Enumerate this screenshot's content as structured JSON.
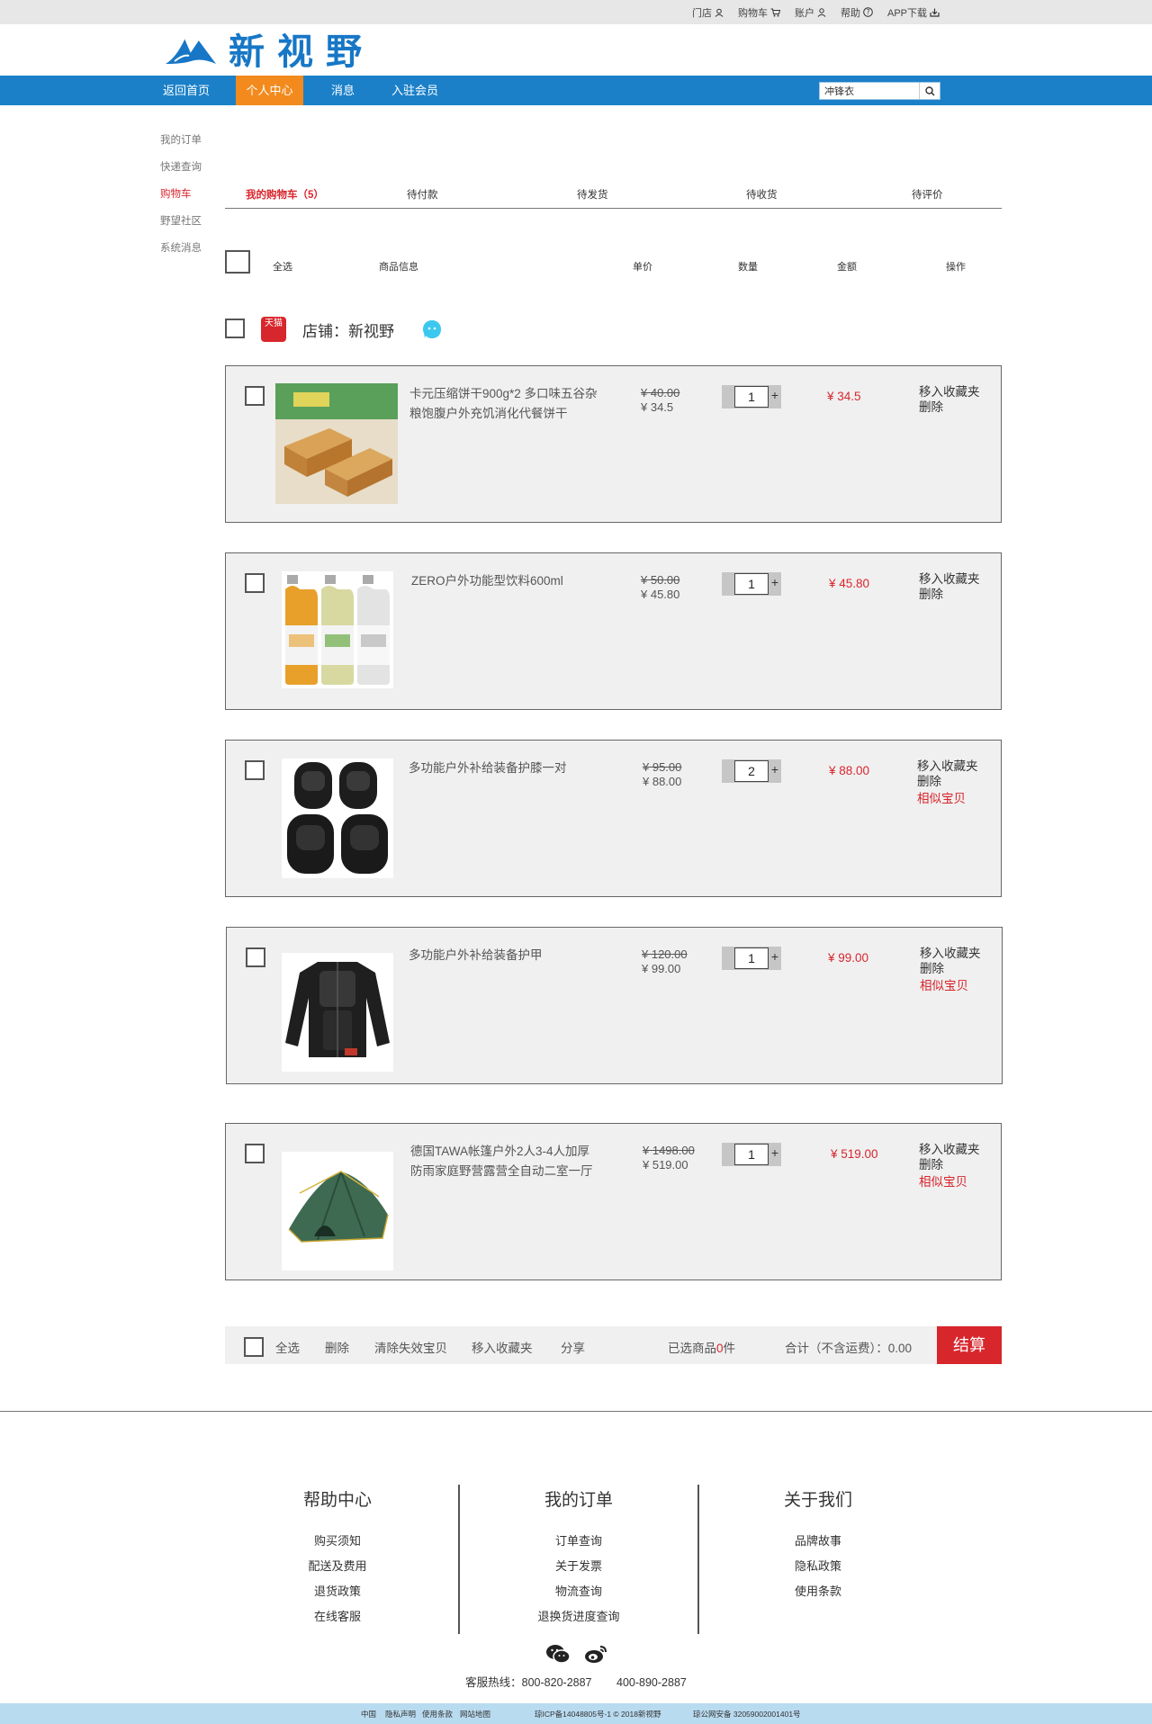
{
  "topbar": {
    "links": [
      {
        "label": "门店",
        "icon": "user-icon"
      },
      {
        "label": "购物车",
        "icon": "cart-icon"
      },
      {
        "label": "账户",
        "icon": "person-icon"
      },
      {
        "label": "帮助",
        "icon": "help-icon"
      },
      {
        "label": "APP下载",
        "icon": "download-icon"
      }
    ]
  },
  "logo": {
    "text": "新视野"
  },
  "nav": {
    "items": [
      "返回首页",
      "个人中心",
      "消息",
      "入驻会员"
    ],
    "active": "个人中心",
    "search_value": "冲锋衣"
  },
  "sidebar": {
    "items": [
      "我的订单",
      "快递查询",
      "购物车",
      "野望社区",
      "系统消息"
    ],
    "active": "购物车"
  },
  "tabs": [
    "我的购物车（5）",
    "待付款",
    "待发货",
    "待收货",
    "待评价"
  ],
  "table_header": [
    "全选",
    "商品信息",
    "单价",
    "数量",
    "金额",
    "操作"
  ],
  "shop": {
    "badge": "天猫",
    "name": "店铺：新视野"
  },
  "items": [
    {
      "title": "卡元压缩饼干900g*2 多口味五谷杂粮饱腹户外充饥消化代餐饼干",
      "orig_price": "¥ 40.00",
      "price": "¥ 34.5",
      "qty": "1",
      "subtotal": "¥ 34.5",
      "ops": [
        "移入收藏夹",
        "删除"
      ],
      "similar": "",
      "image": "biscuit-image"
    },
    {
      "title": "ZERO户外功能型饮料600ml",
      "orig_price": "¥ 50.00",
      "price": "¥ 45.80",
      "qty": "1",
      "subtotal": "¥ 45.80",
      "ops": [
        "移入收藏夹",
        "删除"
      ],
      "similar": "",
      "image": "drink-bottles-image"
    },
    {
      "title": "多功能户外补给装备护膝一对",
      "orig_price": "¥ 95.00",
      "price": "¥ 88.00",
      "qty": "2",
      "subtotal": "¥ 88.00",
      "ops": [
        "移入收藏夹",
        "删除"
      ],
      "similar": "相似宝贝",
      "image": "knee-pads-image"
    },
    {
      "title": "多功能户外补给装备护甲",
      "orig_price": "¥ 120.00",
      "price": "¥ 99.00",
      "qty": "1",
      "subtotal": "¥ 99.00",
      "ops": [
        "移入收藏夹",
        "删除"
      ],
      "similar": "相似宝贝",
      "image": "armor-jacket-image"
    },
    {
      "title": "德国TAWA帐篷户外2人3-4人加厚防雨家庭野营露营全自动二室一厅",
      "orig_price": "¥ 1498.00",
      "price": "¥ 519.00",
      "qty": "1",
      "subtotal": "¥ 519.00",
      "ops": [
        "移入收藏夹",
        "删除"
      ],
      "similar": "相似宝贝",
      "image": "tent-image"
    }
  ],
  "bottom_bar": {
    "select_all": "全选",
    "delete": "删除",
    "clear_invalid": "清除失效宝贝",
    "move_fav": "移入收藏夹",
    "share": "分享",
    "selected_prefix": "已选商品",
    "selected_count": "0",
    "selected_suffix": "件",
    "total_label": "合计（不含运费）：",
    "total_value": "0.00",
    "checkout": "结算"
  },
  "footer": {
    "columns": [
      {
        "title": "帮助中心",
        "links": [
          "购买须知",
          "配送及费用",
          "退货政策",
          "在线客服"
        ]
      },
      {
        "title": "我的订单",
        "links": [
          "订单查询",
          "关于发票",
          "物流查询",
          "退换货进度查询"
        ]
      },
      {
        "title": "关于我们",
        "links": [
          "品牌故事",
          "隐私政策",
          "使用条款"
        ]
      }
    ],
    "hotline_label": "客服热线：",
    "phone1": "800-820-2887",
    "phone2": "400-890-2887",
    "copyright_links": [
      "中国",
      "隐私声明",
      "使用条款",
      "网站地图"
    ],
    "icp": "琼ICP备14048805号-1 © 2018新视野",
    "police": "琼公网安备 32059002001401号"
  },
  "colors": {
    "brand_blue": "#1b80c8",
    "nav_active": "#f28a1d",
    "accent_red": "#d8262d"
  }
}
